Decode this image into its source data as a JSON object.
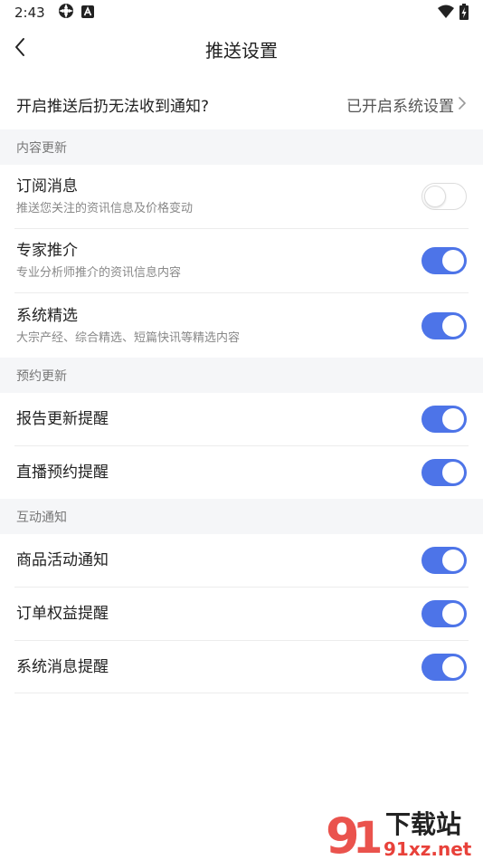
{
  "status_bar": {
    "time": "2:43",
    "icons": [
      "settings-sync-icon",
      "a-notification-icon",
      "wifi-icon",
      "battery-charging-icon"
    ]
  },
  "nav": {
    "title": "推送设置"
  },
  "top_row": {
    "label": "开启推送后扔无法收到通知?",
    "value": "已开启系统设置"
  },
  "sections": [
    {
      "header": "内容更新",
      "items": [
        {
          "title": "订阅消息",
          "subtitle": "推送您关注的资讯信息及价格变动",
          "enabled": false
        },
        {
          "title": "专家推介",
          "subtitle": "专业分析师推介的资讯信息内容",
          "enabled": true
        },
        {
          "title": "系统精选",
          "subtitle": "大宗产经、综合精选、短篇快讯等精选内容",
          "enabled": true
        }
      ]
    },
    {
      "header": "预约更新",
      "items": [
        {
          "title": "报告更新提醒",
          "enabled": true
        },
        {
          "title": "直播预约提醒",
          "enabled": true
        }
      ]
    },
    {
      "header": "互动通知",
      "items": [
        {
          "title": "商品活动通知",
          "enabled": true
        },
        {
          "title": "订单权益提醒",
          "enabled": true
        },
        {
          "title": "系统消息提醒",
          "enabled": true
        }
      ]
    }
  ],
  "watermark": {
    "brand_cn": "下载站",
    "brand_url": "91xz.net"
  },
  "colors": {
    "toggle_on": "#4d74e8",
    "section_bg": "#f5f6f8",
    "watermark_red": "#e8413a"
  }
}
